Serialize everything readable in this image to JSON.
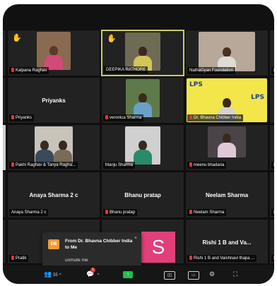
{
  "tiles": {
    "r1": [
      {
        "name": "Kalpana Raghav",
        "hand": true
      },
      {
        "name": "DEEPIKA RATHORE",
        "hand": true
      },
      {
        "name": "NathaGyan Foundation"
      },
      {
        "name": "N"
      }
    ],
    "r2": [
      {
        "name": "Priyanks",
        "center": "Priyanks"
      },
      {
        "name": "veronica Sharma"
      },
      {
        "name": "Dr. Bhavna Chibber India"
      },
      {
        "name": "N"
      }
    ],
    "r3": [
      {
        "name": "Pakhi Raghav & Tanya Ragha..."
      },
      {
        "name": "Manju Sharma"
      },
      {
        "name": "meenu bhadana"
      },
      {
        "name": "N"
      }
    ],
    "r4": [
      {
        "name": "Anaya Sharma 2 c",
        "center": "Anaya Sharma 2 c"
      },
      {
        "name": "Bhanu pratap",
        "center": "Bhanu pratap"
      },
      {
        "name": "Neelam Sharma",
        "center": "Neelam Sharma"
      },
      {
        "name": "N"
      }
    ],
    "r5": [
      {
        "name": "Pratik"
      },
      {
        "name": "Rishi 1 B and Vaishnavi thapa ...",
        "center": "Rishi 1 B and Va..."
      },
      {
        "name": "Y"
      }
    ]
  },
  "lps": {
    "left": "LPS",
    "right": "LPS"
  },
  "notification": {
    "badge": "DB",
    "title": "From Dr. Bhavna Chibber India to Me",
    "message": "unmute me",
    "close": "×"
  },
  "pink_tile": {
    "letter": "S"
  },
  "toolbar": {
    "participants_count": "55",
    "chat_badge": "1",
    "caret": "^",
    "share_symbol": "↑"
  }
}
